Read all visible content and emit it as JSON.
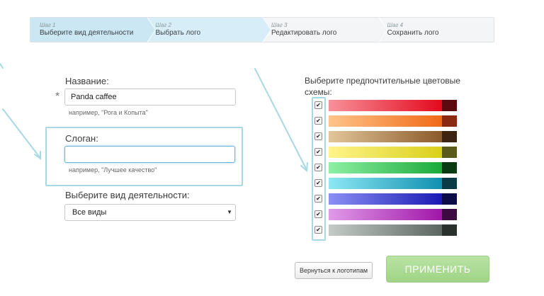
{
  "steps": [
    {
      "num": "Шаг 1",
      "title": "Выберите вид деятельности",
      "state": "done"
    },
    {
      "num": "Шаг 2",
      "title": "Выбрать лого",
      "state": "active"
    },
    {
      "num": "Шаг 3",
      "title": "Редактировать лого",
      "state": "todo"
    },
    {
      "num": "Шаг 4",
      "title": "Сохранить лого",
      "state": "todo"
    }
  ],
  "form": {
    "name_label": "Название:",
    "required_mark": "*",
    "name_value": "Panda caffee",
    "name_hint": "например, \"Рога и Копыта\"",
    "slogan_label": "Слоган:",
    "slogan_value": "",
    "slogan_hint": "например, \"Лучшее качество\"",
    "activity_label": "Выберите вид деятельности:",
    "activity_selected": "Все виды",
    "caret": "▼"
  },
  "schemes": {
    "title": "Выберите предпочтительные цветовые схемы:",
    "check_glyph": "✔",
    "items": [
      {
        "name": "red",
        "from": "#f7919a",
        "to": "#e4091d",
        "swatch": "#5a0a10",
        "checked": true
      },
      {
        "name": "orange",
        "from": "#ffc48a",
        "to": "#f06a18",
        "swatch": "#8b2a12",
        "checked": true
      },
      {
        "name": "brown",
        "from": "#e2c79a",
        "to": "#8c5a2a",
        "swatch": "#3c2410",
        "checked": true
      },
      {
        "name": "yellow",
        "from": "#fff48a",
        "to": "#d9d01a",
        "swatch": "#5a5a1c",
        "checked": true
      },
      {
        "name": "green",
        "from": "#8ef0a4",
        "to": "#1caa3a",
        "swatch": "#0a3a14",
        "checked": true
      },
      {
        "name": "cyan",
        "from": "#8ee8f4",
        "to": "#1090b0",
        "swatch": "#0a3a46",
        "checked": true
      },
      {
        "name": "blue",
        "from": "#8a90f4",
        "to": "#1a1ab4",
        "swatch": "#0c0c46",
        "checked": true
      },
      {
        "name": "purple",
        "from": "#e09ae8",
        "to": "#a016a8",
        "swatch": "#3c0a40",
        "checked": true
      },
      {
        "name": "gray",
        "from": "#c4ccc8",
        "to": "#5c6660",
        "swatch": "#2a302c",
        "checked": true
      }
    ]
  },
  "buttons": {
    "back_label": "Вернуться к логотипам",
    "apply_label": "ПРИМЕНИТЬ"
  },
  "colors": {
    "accent": "#a9d8e4",
    "step_done": "#cbe7f3",
    "apply_green": "#a8d98f"
  }
}
